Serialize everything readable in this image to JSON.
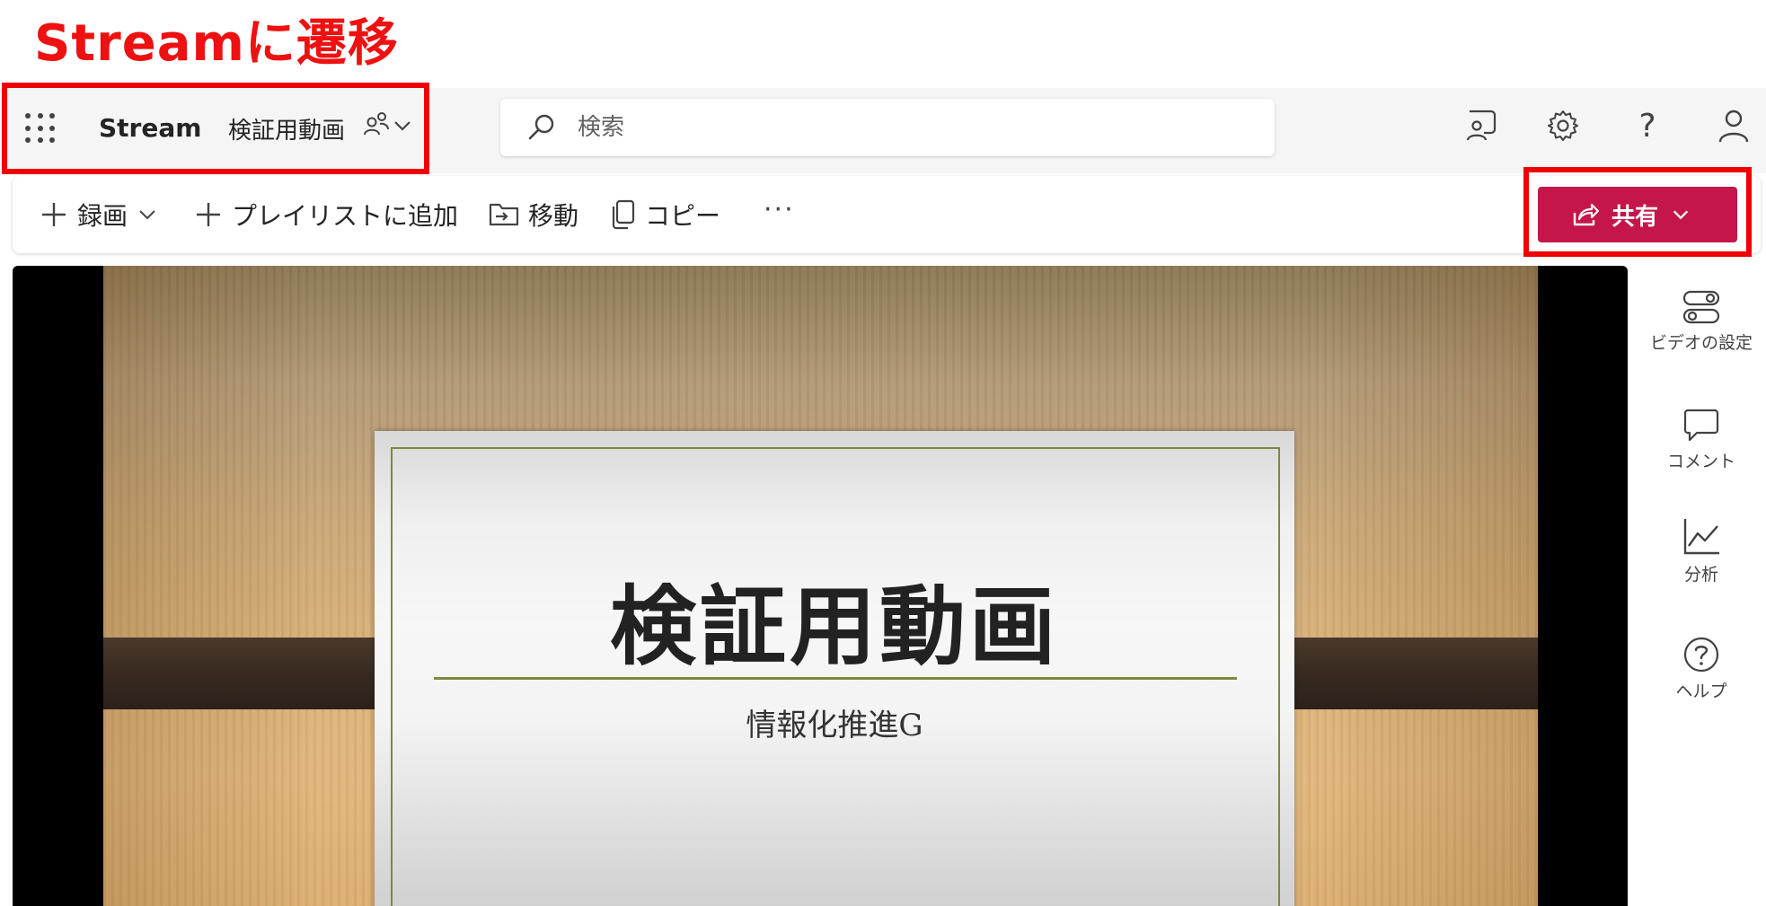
{
  "annotation": {
    "caption": "Streamに遷移",
    "color": "#ee0000"
  },
  "header": {
    "app_name": "Stream",
    "video_title": "検証用動画",
    "search": {
      "placeholder": "検索",
      "value": ""
    },
    "icons": [
      "app-launcher-icon",
      "people-icon",
      "chevron-down-icon",
      "search-icon",
      "feedback-icon",
      "gear-icon",
      "help-icon",
      "person-icon"
    ],
    "help_glyph": "?"
  },
  "toolbar": {
    "record_label": "録画",
    "add_playlist_label": "プレイリストに追加",
    "move_label": "移動",
    "copy_label": "コピー",
    "more_label": "···",
    "share_label": "共有",
    "share_color": "#c4164a"
  },
  "video": {
    "slide_title": "検証用動画",
    "slide_subtitle": "情報化推進G"
  },
  "rail": {
    "settings_label": "ビデオの設定",
    "comments_label": "コメント",
    "analytics_label": "分析",
    "help_label": "ヘルプ"
  }
}
